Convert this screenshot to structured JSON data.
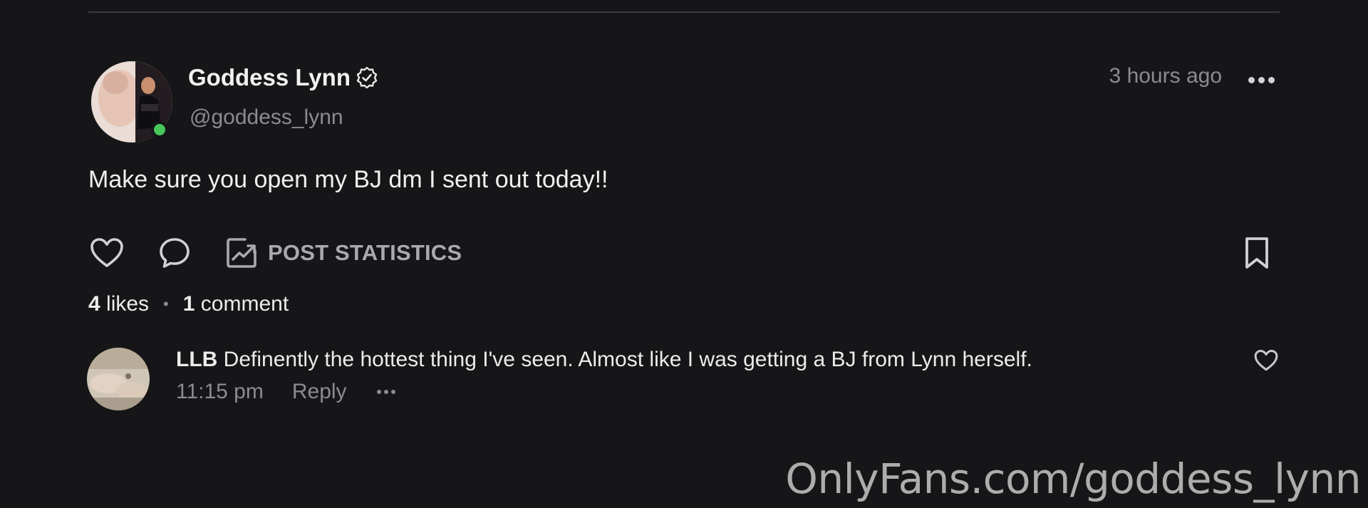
{
  "post": {
    "author_name": "Goddess Lynn",
    "author_handle": "@goddess_lynn",
    "timestamp": "3 hours ago",
    "text": "Make sure you open my BJ dm I sent out today!!",
    "online": true,
    "verified": true
  },
  "actions": {
    "like_icon": "heart-icon",
    "comment_icon": "comment-bubble-icon",
    "stats_icon": "chart-icon",
    "stats_label": "POST STATISTICS",
    "bookmark_icon": "bookmark-icon"
  },
  "counts": {
    "likes_count": "4",
    "likes_label": "likes",
    "comments_count": "1",
    "comments_label": "comment"
  },
  "comments": [
    {
      "author": "LLB",
      "text": "Definently the hottest thing I've seen. Almost like I was getting a BJ from Lynn herself.",
      "time": "11:15 pm",
      "reply_label": "Reply"
    }
  ],
  "watermark": "OnlyFans.com/goddess_lynn",
  "colors": {
    "background": "#161618",
    "online": "#47c65a",
    "muted": "#8a8c90"
  }
}
